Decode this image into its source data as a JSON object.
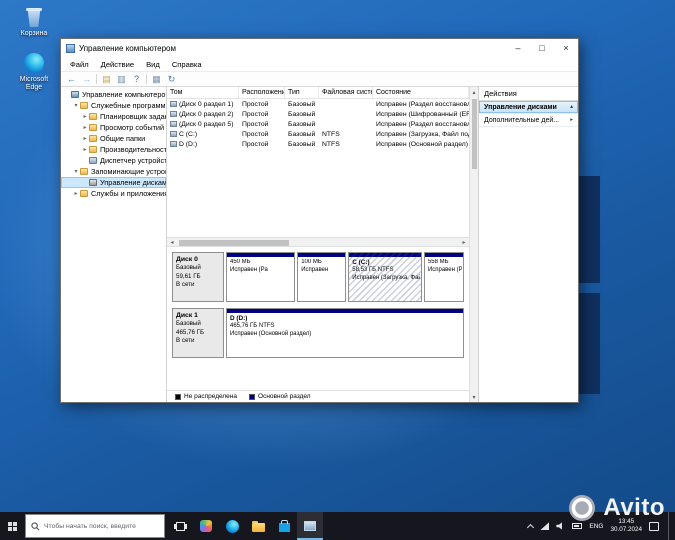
{
  "desktop": {
    "icons": [
      {
        "id": "recycle-bin",
        "label": "Корзина"
      },
      {
        "id": "edge",
        "label": "Microsoft Edge"
      }
    ]
  },
  "window": {
    "title": "Управление компьютером",
    "controls": [
      {
        "name": "minimize-button",
        "glyph": "–"
      },
      {
        "name": "maximize-button",
        "glyph": "□"
      },
      {
        "name": "close-button",
        "glyph": "×"
      }
    ],
    "menu": [
      "Файл",
      "Действие",
      "Вид",
      "Справка"
    ],
    "toolbar": [
      {
        "name": "back-icon",
        "glyph": "←",
        "color": "#2b7cd3"
      },
      {
        "name": "forward-icon",
        "glyph": "→",
        "color": "#9bb8d3",
        "sep": true
      },
      {
        "name": "console-tree-icon",
        "glyph": "▤",
        "color": "#c8a24a"
      },
      {
        "name": "export-list-icon",
        "glyph": "▥",
        "color": "#6f8cab"
      },
      {
        "name": "help-icon",
        "glyph": "?",
        "color": "#3a6ea5",
        "sep": true
      },
      {
        "name": "disk-tools-icon",
        "glyph": "▦",
        "color": "#7a93ad"
      },
      {
        "name": "refresh-icon",
        "glyph": "↻",
        "color": "#4a7fb5"
      }
    ],
    "tree": {
      "items": [
        {
          "name": "computer-management-root",
          "label": "Управление компьютером (л",
          "level": 0,
          "expander": "none",
          "icon": "computer",
          "selected": false
        },
        {
          "name": "system-tools",
          "label": "Служебные программы",
          "level": 1,
          "expander": "expanded",
          "icon": "folder",
          "selected": false
        },
        {
          "name": "task-scheduler",
          "label": "Планировщик заданий",
          "level": 2,
          "expander": "collapsed",
          "icon": "folder",
          "selected": false
        },
        {
          "name": "event-viewer",
          "label": "Просмотр событий",
          "level": 2,
          "expander": "collapsed",
          "icon": "folder",
          "selected": false
        },
        {
          "name": "shared-folders",
          "label": "Общие папки",
          "level": 2,
          "expander": "collapsed",
          "icon": "folder",
          "selected": false
        },
        {
          "name": "performance",
          "label": "Производительность",
          "level": 2,
          "expander": "collapsed",
          "icon": "folder",
          "selected": false
        },
        {
          "name": "device-manager",
          "label": "Диспетчер устройств",
          "level": 2,
          "expander": "none",
          "icon": "device",
          "selected": false
        },
        {
          "name": "storage",
          "label": "Запоминающие устройст",
          "level": 1,
          "expander": "expanded",
          "icon": "folder",
          "selected": false
        },
        {
          "name": "disk-management",
          "label": "Управление дисками",
          "level": 2,
          "expander": "none",
          "icon": "disk",
          "selected": true
        },
        {
          "name": "services-apps",
          "label": "Службы и приложения",
          "level": 1,
          "expander": "collapsed",
          "icon": "folder",
          "selected": false
        }
      ]
    },
    "volumes": {
      "columns": [
        "Том",
        "Расположение",
        "Тип",
        "Файловая система",
        "Состояние"
      ],
      "rows": [
        [
          "(Диск 0 раздел 1)",
          "Простой",
          "Базовый",
          "",
          "Исправен (Раздел восстановления)"
        ],
        [
          "(Диск 0 раздел 2)",
          "Простой",
          "Базовый",
          "",
          "Исправен (Шифрованный (EFI) систе"
        ],
        [
          "(Диск 0 раздел 5)",
          "Простой",
          "Базовый",
          "",
          "Исправен (Раздел восстановления)"
        ],
        [
          "C (C:)",
          "Простой",
          "Базовый",
          "NTFS",
          "Исправен (Загрузка, Файл подкачки,"
        ],
        [
          "D (D:)",
          "Простой",
          "Базовый",
          "NTFS",
          "Исправен (Основной раздел)"
        ]
      ]
    },
    "disk_view": {
      "disks": [
        {
          "name": "Диск 0",
          "type": "Базовый",
          "size": "59,61 ГБ",
          "status": "В сети",
          "partitions": [
            {
              "width_pct": 30,
              "lines": [
                "450 МБ",
                "Исправен (Ра"
              ],
              "selected": false
            },
            {
              "width_pct": 21,
              "lines": [
                "100 МБ",
                "Исправен"
              ],
              "selected": false
            },
            {
              "title": "C (C:)",
              "width_pct": 32,
              "lines": [
                "58,53 ГБ NTFS",
                "Исправен (Загрузка, Файл"
              ],
              "selected": true
            },
            {
              "width_pct": 17,
              "lines": [
                "558 МБ",
                "Исправен (Ра"
              ],
              "selected": false
            }
          ]
        },
        {
          "name": "Диск 1",
          "type": "Базовый",
          "size": "465,76 ГБ",
          "status": "В сети",
          "partitions": [
            {
              "title": "D (D:)",
              "width_pct": 100,
              "lines": [
                "465,76 ГБ NTFS",
                "Исправен (Основной раздел)"
              ],
              "selected": false
            }
          ]
        }
      ],
      "legend": [
        {
          "color": "#000000",
          "label": "Не распределена"
        },
        {
          "color": "#000080",
          "label": "Основной раздел"
        }
      ]
    },
    "actions": {
      "title": "Действия",
      "items": [
        {
          "name": "disk-management",
          "label": "Управление дисками",
          "selected": true
        },
        {
          "name": "more-actions",
          "label": "Дополнительные дей...",
          "selected": false
        }
      ]
    }
  },
  "taskbar": {
    "search_placeholder": "Чтобы начать поиск, введите",
    "icons": [
      {
        "name": "task-view-button",
        "kind": "task-view",
        "active": false
      },
      {
        "name": "news-widget-icon",
        "kind": "colorful",
        "active": false
      },
      {
        "name": "edge-taskbar-icon",
        "kind": "edge",
        "active": false
      },
      {
        "name": "file-explorer-icon",
        "kind": "folder",
        "active": false
      },
      {
        "name": "store-icon",
        "kind": "store",
        "active": false
      },
      {
        "name": "computer-management-taskbar-icon",
        "kind": "mmc",
        "active": true
      }
    ],
    "tray": {
      "lang": "ENG",
      "time": "13:45",
      "date": "30.07.2024"
    }
  },
  "watermark": {
    "brand": "Avito"
  }
}
